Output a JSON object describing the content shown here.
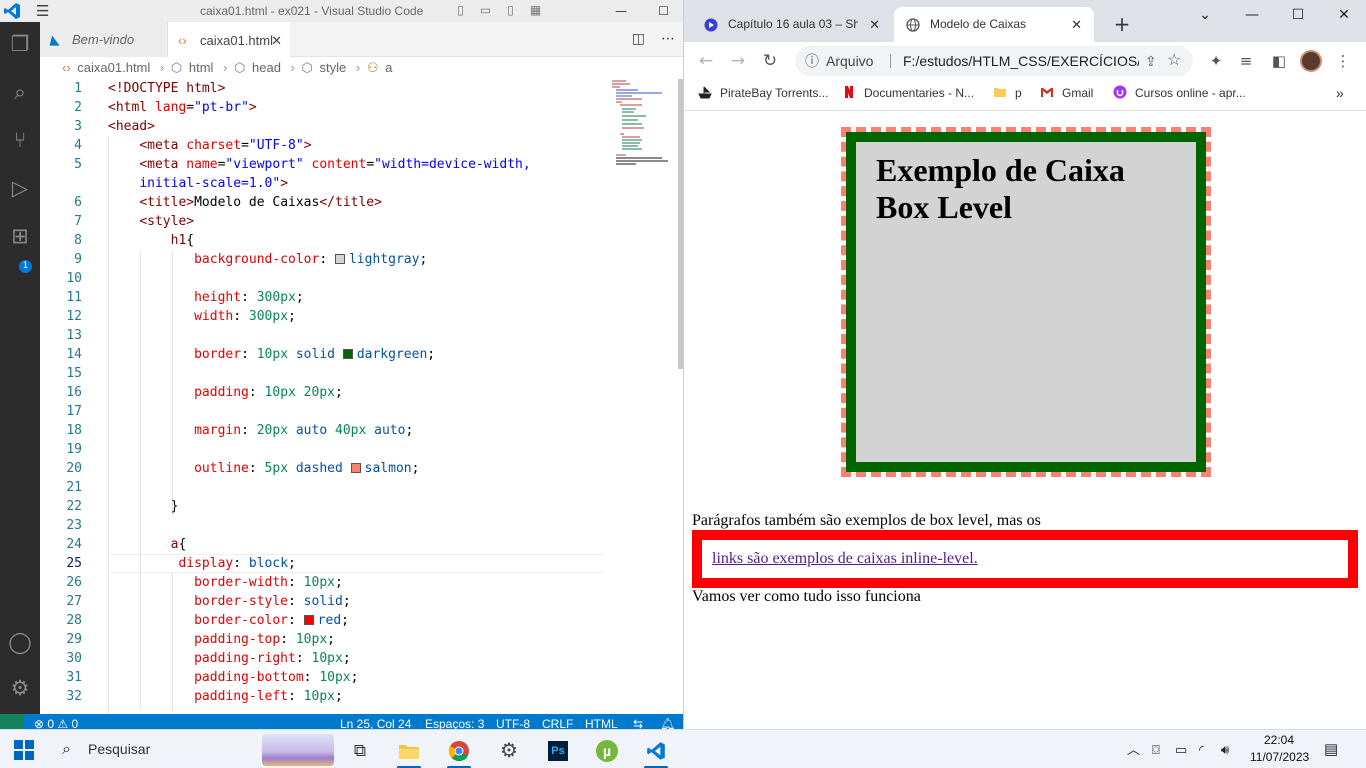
{
  "vscode": {
    "title": "caixa01.html - ex021 - Visual Studio Code",
    "tabs": [
      {
        "label": "Bem-vindo",
        "active": false
      },
      {
        "label": "caixa01.html",
        "active": true
      }
    ],
    "breadcrumb": [
      "caixa01.html",
      "html",
      "head",
      "style",
      "a"
    ],
    "activity_icons": [
      "explorer-icon",
      "search-icon",
      "source-control-icon",
      "run-debug-icon",
      "extensions-icon",
      "account-icon",
      "manage-gear-icon"
    ],
    "extensions_badge": "1",
    "status": {
      "problems": "0",
      "warnings": "0",
      "position": "Ln 25, Col 24",
      "spaces": "Espaços: 3",
      "encoding": "UTF-8",
      "eol": "CRLF",
      "language": "HTML"
    },
    "code_lines": [
      {
        "n": "1",
        "segs": [
          [
            "t-tag",
            "<!DOCTYPE html>"
          ]
        ]
      },
      {
        "n": "2",
        "segs": [
          [
            "t-tag",
            "<html "
          ],
          [
            "t-attr",
            "lang"
          ],
          [
            "t-txt",
            "="
          ],
          [
            "t-str",
            "\"pt-br\""
          ],
          [
            "t-tag",
            ">"
          ]
        ]
      },
      {
        "n": "3",
        "segs": [
          [
            "t-tag",
            "<head>"
          ]
        ]
      },
      {
        "n": "4",
        "segs": [
          [
            "t-txt",
            "    "
          ],
          [
            "t-tag",
            "<meta "
          ],
          [
            "t-attr",
            "charset"
          ],
          [
            "t-txt",
            "="
          ],
          [
            "t-str",
            "\"UTF-8\""
          ],
          [
            "t-tag",
            ">"
          ]
        ]
      },
      {
        "n": "5",
        "segs": [
          [
            "t-txt",
            "    "
          ],
          [
            "t-tag",
            "<meta "
          ],
          [
            "t-attr",
            "name"
          ],
          [
            "t-txt",
            "="
          ],
          [
            "t-str",
            "\"viewport\""
          ],
          [
            "t-txt",
            " "
          ],
          [
            "t-attr",
            "content"
          ],
          [
            "t-txt",
            "="
          ],
          [
            "t-str",
            "\"width=device-width,"
          ]
        ]
      },
      {
        "n": "",
        "segs": [
          [
            "t-txt",
            "    "
          ],
          [
            "t-str",
            "initial-scale=1.0\""
          ],
          [
            "t-tag",
            ">"
          ]
        ]
      },
      {
        "n": "6",
        "segs": [
          [
            "t-txt",
            "    "
          ],
          [
            "t-tag",
            "<title>"
          ],
          [
            "t-txt",
            "Modelo de Caixas"
          ],
          [
            "t-tag",
            "</title>"
          ]
        ]
      },
      {
        "n": "7",
        "segs": [
          [
            "t-txt",
            "    "
          ],
          [
            "t-tag",
            "<style>"
          ]
        ]
      },
      {
        "n": "8",
        "segs": [
          [
            "t-txt",
            "        "
          ],
          [
            "t-sel",
            "h1"
          ],
          [
            "t-txt",
            "{"
          ]
        ]
      },
      {
        "n": "9",
        "segs": [
          [
            "t-txt",
            "           "
          ],
          [
            "t-prop",
            "background-color"
          ],
          [
            "t-txt",
            ": "
          ],
          [
            "sw",
            "#d3d3d3"
          ],
          [
            "t-val",
            "lightgray"
          ],
          [
            "t-txt",
            ";"
          ]
        ]
      },
      {
        "n": "10",
        "segs": []
      },
      {
        "n": "11",
        "segs": [
          [
            "t-txt",
            "           "
          ],
          [
            "t-prop",
            "height"
          ],
          [
            "t-txt",
            ": "
          ],
          [
            "t-num",
            "300px"
          ],
          [
            "t-txt",
            ";"
          ]
        ]
      },
      {
        "n": "12",
        "segs": [
          [
            "t-txt",
            "           "
          ],
          [
            "t-prop",
            "width"
          ],
          [
            "t-txt",
            ": "
          ],
          [
            "t-num",
            "300px"
          ],
          [
            "t-txt",
            ";"
          ]
        ]
      },
      {
        "n": "13",
        "segs": []
      },
      {
        "n": "14",
        "segs": [
          [
            "t-txt",
            "           "
          ],
          [
            "t-prop",
            "border"
          ],
          [
            "t-txt",
            ": "
          ],
          [
            "t-num",
            "10px"
          ],
          [
            "t-txt",
            " "
          ],
          [
            "t-val",
            "solid"
          ],
          [
            "t-txt",
            " "
          ],
          [
            "sw",
            "#006400"
          ],
          [
            "t-val",
            "darkgreen"
          ],
          [
            "t-txt",
            ";"
          ]
        ]
      },
      {
        "n": "15",
        "segs": []
      },
      {
        "n": "16",
        "segs": [
          [
            "t-txt",
            "           "
          ],
          [
            "t-prop",
            "padding"
          ],
          [
            "t-txt",
            ": "
          ],
          [
            "t-num",
            "10px 20px"
          ],
          [
            "t-txt",
            ";"
          ]
        ]
      },
      {
        "n": "17",
        "segs": []
      },
      {
        "n": "18",
        "segs": [
          [
            "t-txt",
            "           "
          ],
          [
            "t-prop",
            "margin"
          ],
          [
            "t-txt",
            ": "
          ],
          [
            "t-num",
            "20px"
          ],
          [
            "t-txt",
            " "
          ],
          [
            "t-val",
            "auto"
          ],
          [
            "t-txt",
            " "
          ],
          [
            "t-num",
            "40px"
          ],
          [
            "t-txt",
            " "
          ],
          [
            "t-val",
            "auto"
          ],
          [
            "t-txt",
            ";"
          ]
        ]
      },
      {
        "n": "19",
        "segs": []
      },
      {
        "n": "20",
        "segs": [
          [
            "t-txt",
            "           "
          ],
          [
            "t-prop",
            "outline"
          ],
          [
            "t-txt",
            ": "
          ],
          [
            "t-num",
            "5px"
          ],
          [
            "t-txt",
            " "
          ],
          [
            "t-val",
            "dashed"
          ],
          [
            "t-txt",
            " "
          ],
          [
            "sw",
            "#fa8072"
          ],
          [
            "t-val",
            "salmon"
          ],
          [
            "t-txt",
            ";"
          ]
        ]
      },
      {
        "n": "21",
        "segs": []
      },
      {
        "n": "22",
        "segs": [
          [
            "t-txt",
            "        "
          ],
          [
            "t-txt",
            "}"
          ]
        ]
      },
      {
        "n": "23",
        "segs": []
      },
      {
        "n": "24",
        "segs": [
          [
            "t-txt",
            "        "
          ],
          [
            "t-sel",
            "a"
          ],
          [
            "t-txt",
            "{"
          ]
        ]
      },
      {
        "n": "25",
        "segs": [
          [
            "t-txt",
            "         "
          ],
          [
            "t-prop",
            "display"
          ],
          [
            "t-txt",
            ": "
          ],
          [
            "t-val",
            "block"
          ],
          [
            "t-txt",
            ";"
          ]
        ]
      },
      {
        "n": "26",
        "segs": [
          [
            "t-txt",
            "           "
          ],
          [
            "t-prop",
            "border-width"
          ],
          [
            "t-txt",
            ": "
          ],
          [
            "t-num",
            "10px"
          ],
          [
            "t-txt",
            ";"
          ]
        ]
      },
      {
        "n": "27",
        "segs": [
          [
            "t-txt",
            "           "
          ],
          [
            "t-prop",
            "border-style"
          ],
          [
            "t-txt",
            ": "
          ],
          [
            "t-val",
            "solid"
          ],
          [
            "t-txt",
            ";"
          ]
        ]
      },
      {
        "n": "28",
        "segs": [
          [
            "t-txt",
            "           "
          ],
          [
            "t-prop",
            "border-color"
          ],
          [
            "t-txt",
            ": "
          ],
          [
            "sw",
            "#ff0000"
          ],
          [
            "t-val",
            "red"
          ],
          [
            "t-txt",
            ";"
          ]
        ]
      },
      {
        "n": "29",
        "segs": [
          [
            "t-txt",
            "           "
          ],
          [
            "t-prop",
            "padding-top"
          ],
          [
            "t-txt",
            ": "
          ],
          [
            "t-num",
            "10px"
          ],
          [
            "t-txt",
            ";"
          ]
        ]
      },
      {
        "n": "30",
        "segs": [
          [
            "t-txt",
            "           "
          ],
          [
            "t-prop",
            "padding-right"
          ],
          [
            "t-txt",
            ": "
          ],
          [
            "t-num",
            "10px"
          ],
          [
            "t-txt",
            ";"
          ]
        ]
      },
      {
        "n": "31",
        "segs": [
          [
            "t-txt",
            "           "
          ],
          [
            "t-prop",
            "padding-bottom"
          ],
          [
            "t-txt",
            ": "
          ],
          [
            "t-num",
            "10px"
          ],
          [
            "t-txt",
            ";"
          ]
        ]
      },
      {
        "n": "32",
        "segs": [
          [
            "t-txt",
            "           "
          ],
          [
            "t-prop",
            "padding-left"
          ],
          [
            "t-txt",
            ": "
          ],
          [
            "t-num",
            "10px"
          ],
          [
            "t-txt",
            ";"
          ]
        ]
      }
    ]
  },
  "chrome": {
    "tabs": [
      {
        "label": "Capítulo 16 aula 03 – Shor",
        "active": false
      },
      {
        "label": "Modelo de Caixas",
        "active": true
      }
    ],
    "omnibox": {
      "scheme_label": "Arquivo",
      "url": "F:/estudos/HTLM_CSS/EXERCÍCIOS/..."
    },
    "bookmarks": [
      "PirateBay Torrents...",
      "Documentaries - N...",
      "p",
      "Gmail",
      "Cursos online - apr..."
    ],
    "page": {
      "h1": "Exemplo de Caixa Box Level",
      "p1": "Parágrafos também são exemplos de box level, mas os",
      "link": "links são exemplos de caixas inline-level.",
      "p2": "Vamos ver como tudo isso funciona"
    }
  },
  "taskbar": {
    "search_label": "Pesquisar",
    "time": "22:04",
    "date": "11/07/2023"
  }
}
